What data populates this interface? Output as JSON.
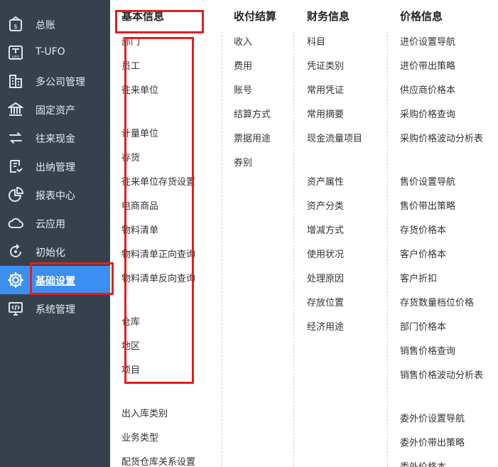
{
  "sidebar": {
    "items": [
      {
        "label": "总账",
        "icon": "ledger-icon"
      },
      {
        "label": "T-UFO",
        "icon": "ufo-icon"
      },
      {
        "label": "多公司管理",
        "icon": "building-icon"
      },
      {
        "label": "固定资产",
        "icon": "bank-icon"
      },
      {
        "label": "往来现金",
        "icon": "exchange-icon"
      },
      {
        "label": "出纳管理",
        "icon": "cashier-icon"
      },
      {
        "label": "报表中心",
        "icon": "pie-chart-icon"
      },
      {
        "label": "云应用",
        "icon": "cloud-icon"
      },
      {
        "label": "初始化",
        "icon": "refresh-icon"
      },
      {
        "label": "基础设置",
        "icon": "settings-gear-icon",
        "active": true
      },
      {
        "label": "系统管理",
        "icon": "monitor-code-icon"
      }
    ]
  },
  "menu": {
    "columns": [
      {
        "title": "基本信息",
        "items": [
          "部门",
          "员工",
          "往来单位",
          "计量单位",
          "存货",
          "往来单位存货设置",
          "电商商品",
          "物料清单",
          "物料清单正向查询",
          "物料清单反向查询",
          "仓库",
          "地区",
          "项目",
          "出入库类别",
          "业务类型",
          "配货仓库关系设置"
        ]
      },
      {
        "title": "收付结算",
        "items": [
          "收入",
          "费用",
          "账号",
          "结算方式",
          "票据用途",
          "券别"
        ]
      },
      {
        "title": "财务信息",
        "items": [
          "科目",
          "凭证类别",
          "常用凭证",
          "常用摘要",
          "现金流量项目",
          "资产属性",
          "资产分类",
          "增减方式",
          "使用状况",
          "处理原因",
          "存放位置",
          "经济用途"
        ]
      },
      {
        "title": "价格信息",
        "items": [
          "进价设置导航",
          "进价带出策略",
          "供应商价格本",
          "采购价格查询",
          "采购价格波动分析表",
          "售价设置导航",
          "售价带出策略",
          "存货价格本",
          "客户价格本",
          "客户折扣",
          "存货数量档位价格",
          "部门价格本",
          "销售价格查询",
          "销售价格波动分析表",
          "委外价设置导航",
          "委外价带出策略",
          "委外价格本"
        ]
      }
    ]
  },
  "colors": {
    "sidebar_bg": "#37414e",
    "active_bg": "#3b8ff0",
    "highlight_box": "#e02020"
  }
}
